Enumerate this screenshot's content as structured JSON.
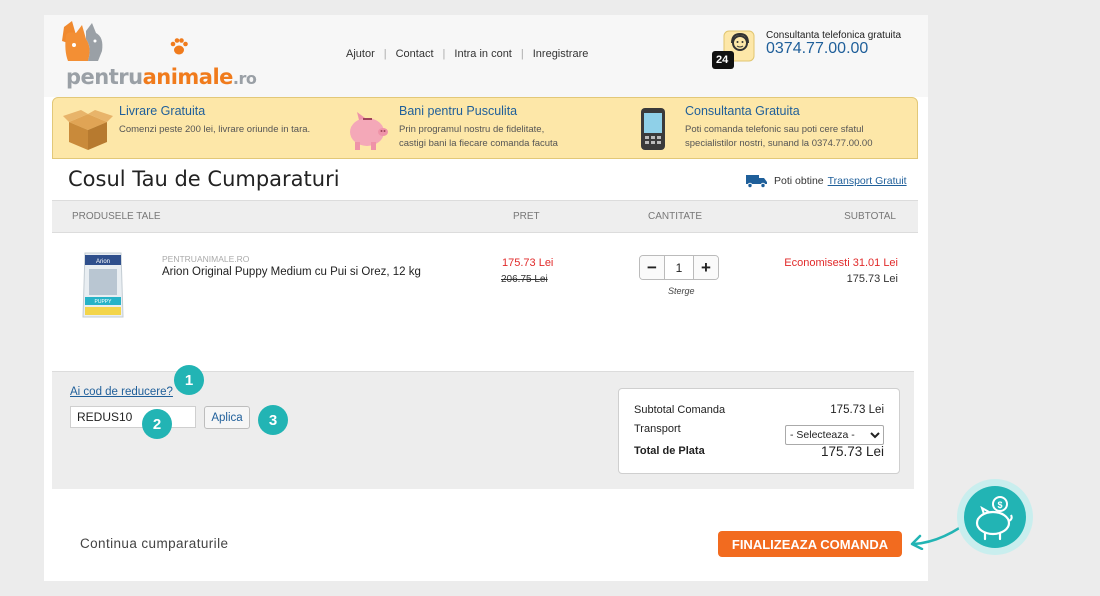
{
  "header": {
    "logo": {
      "part1": "pentru",
      "part2": "animale",
      "part3": ".ro"
    },
    "nav": [
      "Ajutor",
      "Contact",
      "Intra in cont",
      "Inregistrare"
    ],
    "phone": {
      "caption": "Consultanta telefonica gratuita",
      "number": "0374.77.00.00",
      "badge": "24"
    }
  },
  "benefits": [
    {
      "icon": "box-icon",
      "title": "Livrare Gratuita",
      "lines": [
        "Comenzi peste 200 lei, livrare oriunde in tara."
      ]
    },
    {
      "icon": "piggy-bank-icon",
      "title": "Bani pentru Pusculita",
      "lines": [
        "Prin programul nostru de fidelitate,",
        "castigi bani la fiecare comanda facuta"
      ]
    },
    {
      "icon": "mobile-phone-icon",
      "title": "Consultanta Gratuita",
      "lines": [
        "Poti comanda telefonic sau poti cere sfatul",
        "specialistilor nostri, sunand la 0374.77.00.00"
      ]
    }
  ],
  "cart": {
    "title": "Cosul Tau de Cumparaturi",
    "transport_text": "Poti obtine",
    "transport_link": "Transport Gratuit",
    "columns": {
      "products": "PRODUSELE TALE",
      "price": "PRET",
      "quantity": "CANTITATE",
      "subtotal": "SUBTOTAL"
    },
    "item": {
      "brand": "PENTRUANIMALE.RO",
      "name": "Arion Original Puppy Medium cu Pui si Orez, 12 kg",
      "price_new": "175.73 Lei",
      "price_old": "206.75 Lei",
      "quantity": "1",
      "remove": "Sterge",
      "savings": "Economisesti 31.01 Lei",
      "subtotal": "175.73 Lei",
      "package_brand": "Arion",
      "package_label": "PUPPY"
    }
  },
  "coupon": {
    "link": "Ai cod de reducere?",
    "value": "REDUS10",
    "apply": "Aplica",
    "steps": [
      "1",
      "2",
      "3"
    ]
  },
  "summary": {
    "subtotal_label": "Subtotal Comanda",
    "subtotal_value": "175.73 Lei",
    "transport_label": "Transport",
    "transport_select": "- Selecteaza -",
    "total_label": "Total de Plata",
    "total_value": "175.73 Lei"
  },
  "actions": {
    "continue": "Continua cumparaturile",
    "finalize": "FINALIZEAZA COMANDA"
  },
  "colors": {
    "accent": "#f26b1f",
    "link": "#1f5f9a",
    "teal": "#22b4b4",
    "banner": "#fde7a8",
    "sale": "#e12a2a"
  }
}
